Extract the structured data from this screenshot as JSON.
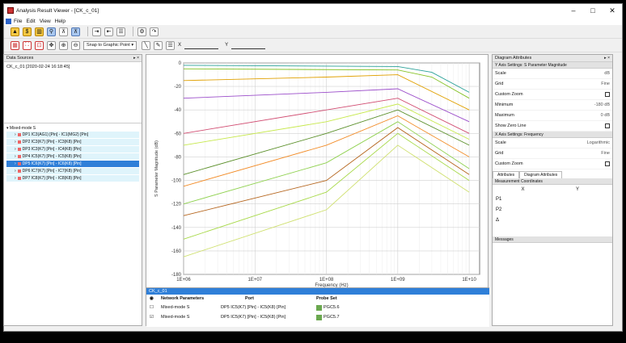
{
  "window": {
    "title": "Analysis Result Viewer - [CK_c_01]"
  },
  "menu": [
    "File",
    "Edit",
    "View",
    "Help"
  ],
  "toolbar2": {
    "snap_label": "Snap to Graphic Point",
    "x_label": "X",
    "y_label": "Y"
  },
  "data_sources": {
    "header": "Data Sources",
    "file_entry": "CK_c_01 [2020-02-24 16:18:45]",
    "root": "Mixed-mode S",
    "items": [
      "DP1 IC3(AG1) [Pin] - IC1(MG2) [Pin]",
      "DP2 IC3(K7) [Pin] - IC3(K8) [Pin]",
      "DP3 IC3(K7) [Pin] - IC4(K8) [Pin]",
      "DP4 IC5(K7) [Pin] - IC5(K8) [Pin]",
      "DP5 IC6(K7) [Pin] - IC6(K8) [Pin]",
      "DP6 IC7(K7) [Pin] - IC7(K8) [Pin]",
      "DP7 IC8(K7) [Pin] - IC8(K8) [Pin]"
    ]
  },
  "bottom": {
    "tab": "CK_c_01",
    "columns": [
      "Network Parameters",
      "Port",
      "Probe Set"
    ],
    "rows": [
      {
        "param": "Mixed-mode S",
        "port": "DP5 IC5(K7) [Pin] - IC5(K8) [Pin]",
        "probe": "PGC5.6"
      },
      {
        "param": "Mixed-mode S",
        "port": "DP5 IC5(K7) [Pin] - IC5(K8) [Pin]",
        "probe": "PGC5.7"
      }
    ]
  },
  "diagram_attributes": {
    "header": "Diagram Attributes",
    "y_axis": {
      "title": "Y Axis Settings: S Parameter Magnitude",
      "rows": [
        {
          "label": "Scale",
          "value": "dB"
        },
        {
          "label": "Grid",
          "value": "Fine"
        },
        {
          "label": "Custom Zoom",
          "value": ""
        },
        {
          "label": "Minimum",
          "value": "-180 dB"
        },
        {
          "label": "Maximum",
          "value": "0 dB"
        },
        {
          "label": "Show Zero Line",
          "value": ""
        }
      ]
    },
    "x_axis": {
      "title": "X Axis Settings: Frequency",
      "rows": [
        {
          "label": "Scale",
          "value": "Logarithmic"
        },
        {
          "label": "Grid",
          "value": "Fine"
        },
        {
          "label": "Custom Zoom",
          "value": ""
        }
      ]
    },
    "tabs": [
      "Attributes",
      "Diagram Attributes"
    ]
  },
  "measurement": {
    "header": "Measurement Coordinates",
    "col_x": "X",
    "col_y": "Y",
    "rows": [
      "P1",
      "P2",
      "Δ"
    ]
  },
  "messages": {
    "header": "Messages"
  },
  "chart_data": {
    "type": "line",
    "xlabel": "Frequency (Hz)",
    "ylabel": "S Parameter Magnitude (dB)",
    "x_ticks": [
      "1E+06",
      "1E+07",
      "1E+08",
      "1E+09",
      "1E+10"
    ],
    "y_ticks": [
      "0",
      "-20",
      "-40",
      "-60",
      "-80",
      "-100",
      "-120",
      "-140",
      "-160",
      "-180"
    ],
    "x_range": [
      1000000,
      14000000000
    ],
    "ylim": [
      -180,
      0
    ],
    "log_x": true,
    "grid": true,
    "series": [
      {
        "color": "#2aa198",
        "points": [
          [
            1000000,
            -2
          ],
          [
            1000000000,
            -3
          ],
          [
            3000000000,
            -8
          ],
          [
            10000000000,
            -25
          ]
        ]
      },
      {
        "color": "#85c225",
        "points": [
          [
            1000000,
            -5
          ],
          [
            1000000000,
            -6
          ],
          [
            3000000000,
            -12
          ],
          [
            10000000000,
            -30
          ]
        ]
      },
      {
        "color": "#e0a000",
        "points": [
          [
            1000000,
            -15
          ],
          [
            100000000,
            -12
          ],
          [
            1000000000,
            -10
          ],
          [
            10000000000,
            -40
          ]
        ]
      },
      {
        "color": "#9b4dca",
        "points": [
          [
            1000000,
            -30
          ],
          [
            100000000,
            -25
          ],
          [
            1000000000,
            -22
          ],
          [
            10000000000,
            -50
          ]
        ]
      },
      {
        "color": "#d14d72",
        "points": [
          [
            1000000,
            -60
          ],
          [
            100000000,
            -40
          ],
          [
            1000000000,
            -30
          ],
          [
            10000000000,
            -60
          ]
        ]
      },
      {
        "color": "#c6e84b",
        "points": [
          [
            1000000,
            -70
          ],
          [
            100000000,
            -50
          ],
          [
            1000000000,
            -35
          ],
          [
            10000000000,
            -65
          ]
        ]
      },
      {
        "color": "#5a8f29",
        "points": [
          [
            1000000,
            -95
          ],
          [
            100000000,
            -60
          ],
          [
            1000000000,
            -40
          ],
          [
            10000000000,
            -70
          ]
        ]
      },
      {
        "color": "#f28c28",
        "points": [
          [
            1000000,
            -105
          ],
          [
            100000000,
            -70
          ],
          [
            1000000000,
            -45
          ],
          [
            10000000000,
            -80
          ]
        ]
      },
      {
        "color": "#8fd14f",
        "points": [
          [
            1000000,
            -120
          ],
          [
            100000000,
            -85
          ],
          [
            1000000000,
            -50
          ],
          [
            10000000000,
            -90
          ]
        ]
      },
      {
        "color": "#b5651d",
        "points": [
          [
            1000000,
            -130
          ],
          [
            100000000,
            -100
          ],
          [
            1000000000,
            -55
          ],
          [
            10000000000,
            -95
          ]
        ]
      },
      {
        "color": "#a7d948",
        "points": [
          [
            1000000,
            -150
          ],
          [
            100000000,
            -110
          ],
          [
            1000000000,
            -60
          ],
          [
            10000000000,
            -100
          ]
        ]
      },
      {
        "color": "#cfe06e",
        "points": [
          [
            1000000,
            -165
          ],
          [
            100000000,
            -125
          ],
          [
            1000000000,
            -70
          ],
          [
            10000000000,
            -110
          ]
        ]
      }
    ]
  }
}
